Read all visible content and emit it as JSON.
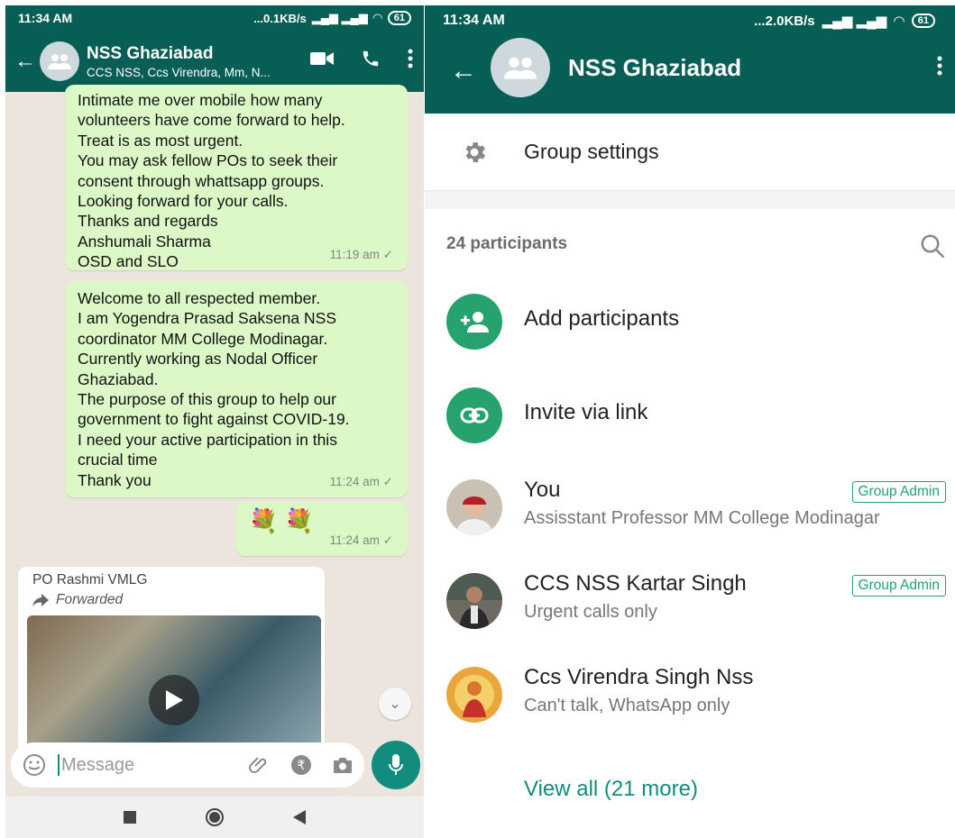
{
  "left": {
    "status": {
      "time": "11:34 AM",
      "speed": "...0.1KB/s",
      "battery": "61"
    },
    "header": {
      "title": "NSS Ghaziabad",
      "subtitle": "CCS NSS, Ccs Virendra, Mm, N..."
    },
    "messages": [
      {
        "lines": [
          "Intimate me over mobile how many",
          "volunteers have come forward to help.",
          "Treat is as most urgent.",
          "You may ask fellow POs to seek their",
          "consent through whattsapp groups.",
          "Looking forward for your calls.",
          "Thanks and regards",
          "Anshumali Sharma",
          "OSD and SLO"
        ],
        "time": "11:19 am ✓"
      },
      {
        "lines": [
          "Welcome to all respected member.",
          "I am Yogendra Prasad Saksena NSS",
          "coordinator MM College Modinagar.",
          "Currently working as Nodal Officer",
          "Ghaziabad.",
          "The purpose of this group to help our",
          "government to fight against COVID-19.",
          "I need your active participation in this",
          "crucial time",
          "Thank you"
        ],
        "time": "11:24 am ✓"
      },
      {
        "emoji": "💐 💐",
        "time": "11:24 am ✓"
      }
    ],
    "incoming": {
      "sender": "PO Rashmi VMLG",
      "forwarded": "Forwarded"
    },
    "input": {
      "placeholder": "Message"
    }
  },
  "right": {
    "status": {
      "time": "11:34 AM",
      "speed": "...2.0KB/s",
      "battery": "61"
    },
    "header": {
      "title": "NSS Ghaziabad"
    },
    "settings_label": "Group settings",
    "participants_count": "24 participants",
    "actions": {
      "add": "Add participants",
      "invite": "Invite via link"
    },
    "participants": [
      {
        "name": "You",
        "status": "Assisstant Professor MM College Modinagar",
        "badge": "Group Admin"
      },
      {
        "name": "CCS NSS Kartar Singh",
        "status": "Urgent calls only",
        "badge": "Group Admin"
      },
      {
        "name": "Ccs Virendra Singh Nss",
        "status": "Can't talk, WhatsApp only"
      }
    ],
    "view_all": "View all (21 more)"
  },
  "colors": {
    "header": "#075e54",
    "accent": "#25a26e",
    "outgoing_bubble": "#dcf8c6",
    "chat_bg": "#ece5dd"
  }
}
